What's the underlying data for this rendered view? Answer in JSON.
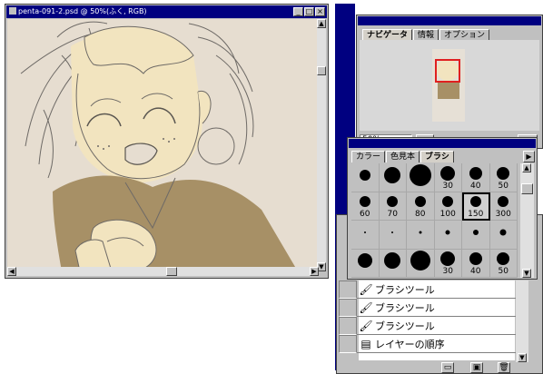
{
  "document": {
    "title": "penta-091-2.psd @ 50%(ふく, RGB)"
  },
  "navigator": {
    "tabs": [
      "ナビゲータ",
      "情報",
      "オプション"
    ],
    "zoom": "50%"
  },
  "brushes": {
    "tabs": [
      "カラー",
      "色見本",
      "ブラシ"
    ],
    "cells": [
      {
        "size": 12,
        "label": ""
      },
      {
        "size": 18,
        "label": ""
      },
      {
        "size": 24,
        "label": ""
      },
      {
        "size": 16,
        "label": "30"
      },
      {
        "size": 14,
        "label": "40"
      },
      {
        "size": 14,
        "label": "50"
      },
      {
        "size": 12,
        "label": "60"
      },
      {
        "size": 12,
        "label": "70"
      },
      {
        "size": 12,
        "label": "80"
      },
      {
        "size": 12,
        "label": "100"
      },
      {
        "size": 12,
        "label": "150"
      },
      {
        "size": 12,
        "label": "300"
      },
      {
        "size": 2,
        "label": ""
      },
      {
        "size": 2,
        "label": ""
      },
      {
        "size": 3,
        "label": ""
      },
      {
        "size": 5,
        "label": ""
      },
      {
        "size": 6,
        "label": ""
      },
      {
        "size": 7,
        "label": ""
      },
      {
        "size": 16,
        "label": ""
      },
      {
        "size": 18,
        "label": ""
      },
      {
        "size": 22,
        "label": ""
      },
      {
        "size": 16,
        "label": "30"
      },
      {
        "size": 14,
        "label": "40"
      },
      {
        "size": 14,
        "label": "50"
      }
    ],
    "selected_index": 10
  },
  "history": {
    "items": [
      {
        "icon": "brush-icon",
        "label": "ブラシツール"
      },
      {
        "icon": "brush-icon",
        "label": "ブラシツール"
      },
      {
        "icon": "brush-icon",
        "label": "ブラシツール"
      },
      {
        "icon": "layer-order-icon",
        "label": "レイヤーの順序"
      }
    ]
  }
}
